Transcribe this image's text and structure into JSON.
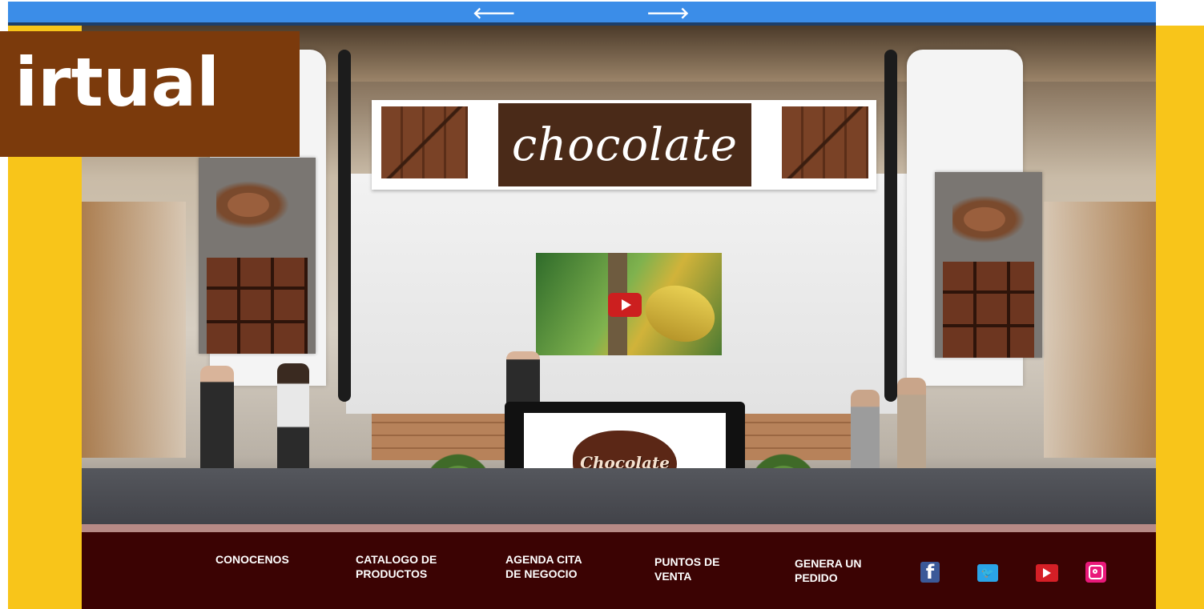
{
  "nav": {
    "prev_icon": "arrow-left-icon",
    "next_icon": "arrow-right-icon",
    "prev_glyph": "🡐",
    "next_glyph": "🡒"
  },
  "overlay": {
    "title": "irtual"
  },
  "booth": {
    "banner_logo": "chocolate",
    "counter_logo": "Chocolate",
    "video_icon": "youtube-play-icon"
  },
  "footer": {
    "menu": [
      {
        "label": "CONOCENOS"
      },
      {
        "label": "CATALOGO DE\nPRODUCTOS"
      },
      {
        "label": "AGENDA CITA\nDE NEGOCIO"
      },
      {
        "label": "PUNTOS DE\nVENTA"
      },
      {
        "label": "GENERA UN\nPEDIDO"
      }
    ],
    "social": [
      {
        "name": "facebook-icon",
        "glyph": "f"
      },
      {
        "name": "twitter-icon",
        "glyph": "🐦"
      },
      {
        "name": "youtube-icon"
      },
      {
        "name": "instagram-icon"
      }
    ]
  },
  "colors": {
    "topbar": "#3b8de8",
    "side_panels": "#f8c51a",
    "overlay": "#7b3a0c",
    "footer": "#3b0303"
  }
}
